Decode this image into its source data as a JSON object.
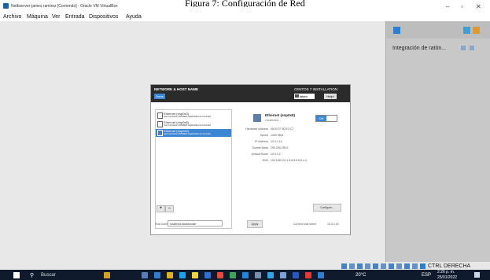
{
  "caption": "Figura 7: Configuración de Red",
  "window": {
    "title": "Netbserver-james ramirez [Corriendo] - Oracle VM VirtualBox",
    "controls": [
      "–",
      "▫",
      "✕"
    ]
  },
  "menu": [
    "Archivo",
    "Máquina",
    "Ver",
    "Entrada",
    "Dispositivos",
    "Ayuda"
  ],
  "installer": {
    "section_title": "NETWORK & HOST NAME",
    "done_button": "Done",
    "header_right": "CENTOS 7 INSTALLATION",
    "keyboard": "latam",
    "help_button": "Help!",
    "adapters": [
      {
        "name": "Ethernet (enp0s3)",
        "desc": "Intel Corporation 82540EM Gigabit Ethernet Controller"
      },
      {
        "name": "Ethernet (enp0s8)",
        "desc": "Intel Corporation 82540EM Gigabit Ethernet Controller"
      },
      {
        "name": "Ethernet (enp0s9)",
        "desc": "Intel Corporation 82540EM Gigabit Ethernet Controller"
      }
    ],
    "detail": {
      "name": "Ethernet (enp0s9)",
      "status": "Connected",
      "toggle": "ON",
      "hw_label": "Hardware Address",
      "hw_value": "08:00:27:50:E2:C7",
      "speed_label": "Speed",
      "speed_value": "1000 Mb/s",
      "ip_label": "IP Address",
      "ip_value": "10.0.4.15",
      "mask_label": "Subnet Mask",
      "mask_value": "255.255.255.0",
      "route_label": "Default Route",
      "route_value": "10.0.4.2",
      "dns_label": "DNS",
      "dns_value": "192.168.101.1 8.8.8.8 8.8.4.4"
    },
    "configure_button": "Configure...",
    "add_button": "+",
    "remove_button": "–",
    "hostname_label": "Host name:",
    "hostname_value": "localhost.localdomain",
    "apply_button": "Apply",
    "current_hostname_label": "Current host name:",
    "current_hostname_value": "10.0.4.15"
  },
  "side_panel": {
    "item": "Integración de ratón..."
  },
  "status": {
    "host_key": "CTRL DERECHA"
  },
  "taskbar": {
    "search": "Buscar",
    "weather": "20°C",
    "lang": "ESP",
    "time": "2:26 p. m.",
    "date": "25/01/2022"
  },
  "colors": {
    "accent": "#3c86d4",
    "taskbar": "#0f1b2d",
    "installer_header": "#2b2b2b"
  }
}
